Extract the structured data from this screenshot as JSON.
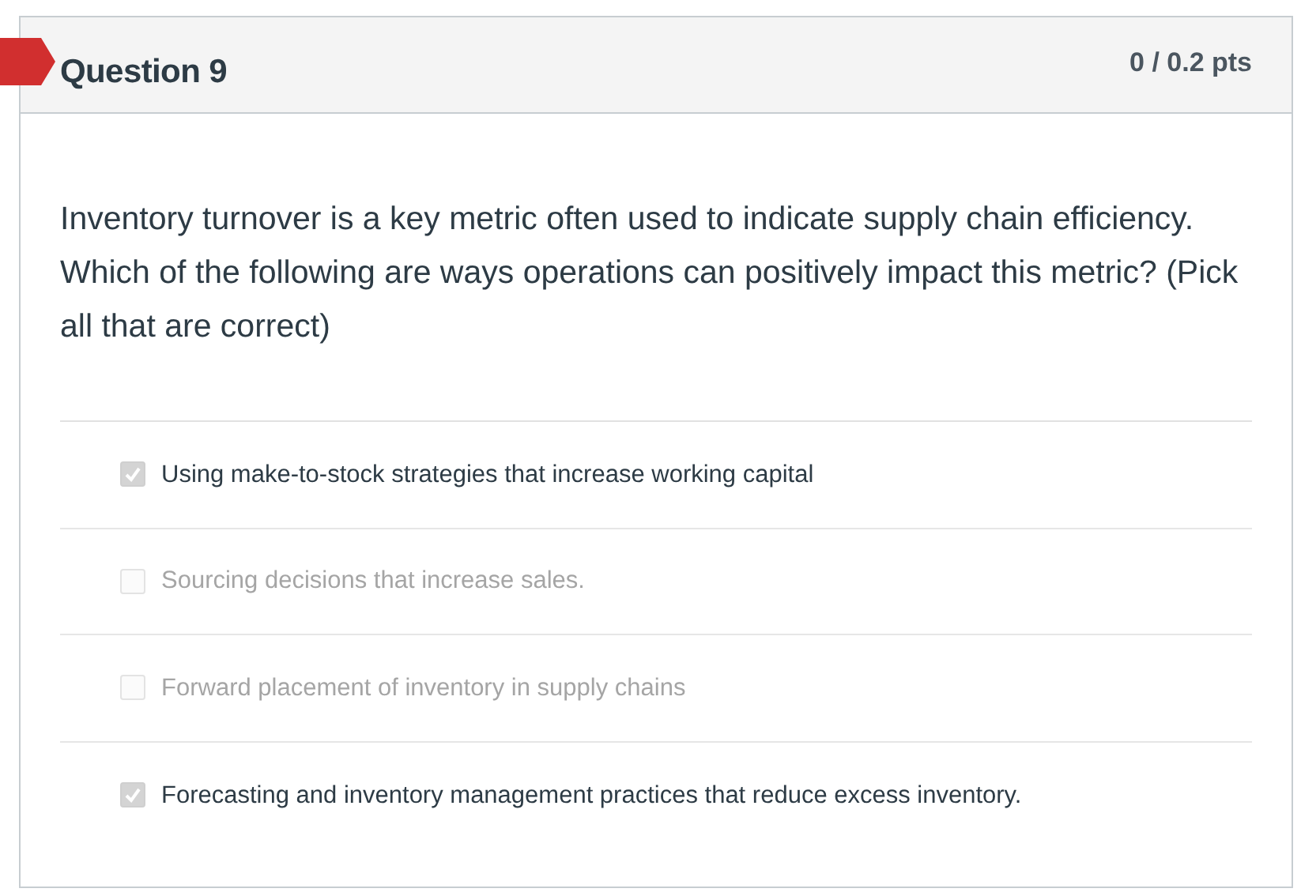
{
  "question": {
    "title": "Question 9",
    "points": "0 / 0.2 pts",
    "flagged": true,
    "text": "Inventory turnover is a key metric often used to indicate supply chain efficiency.  Which of the following are ways operations can positively impact this metric? (Pick all that are correct)",
    "answers": [
      {
        "label": "Using make-to-stock strategies that increase working capital",
        "checked": true
      },
      {
        "label": "Sourcing decisions that increase sales.",
        "checked": false
      },
      {
        "label": "Forward placement of inventory in supply chains",
        "checked": false
      },
      {
        "label": "Forecasting and inventory management practices that reduce excess inventory.",
        "checked": true
      }
    ]
  }
}
